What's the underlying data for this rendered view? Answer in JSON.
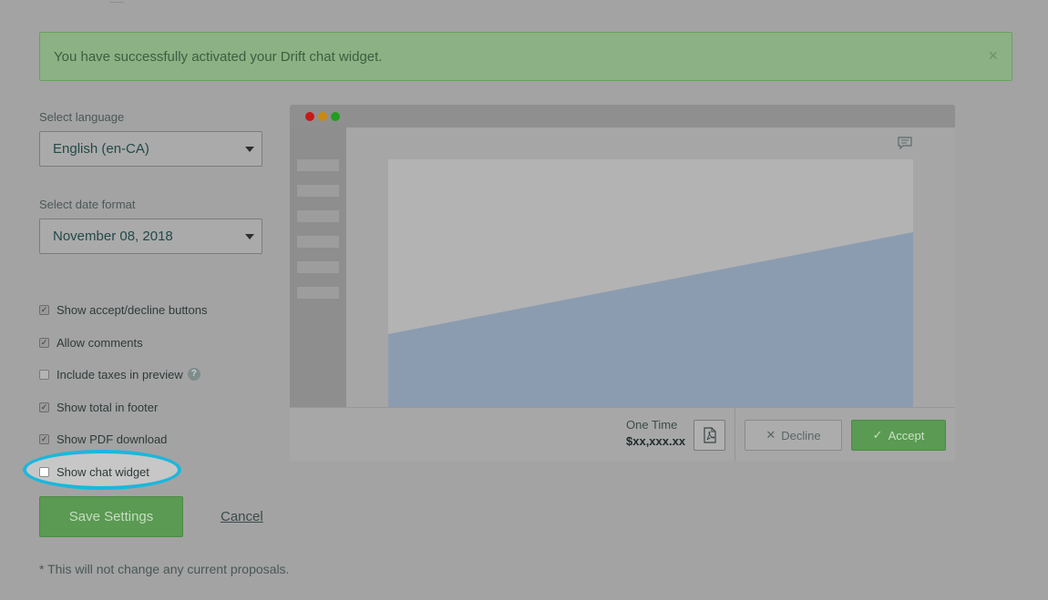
{
  "banner": {
    "message": "You have successfully activated your Drift chat widget.",
    "close_glyph": "×"
  },
  "language": {
    "label": "Select language",
    "value": "English (en-CA)"
  },
  "date_format": {
    "label": "Select date format",
    "value": "November 08, 2018"
  },
  "options": [
    {
      "label": "Show accept/decline buttons",
      "checked": true
    },
    {
      "label": "Allow comments",
      "checked": true
    },
    {
      "label": "Include taxes in preview",
      "checked": false,
      "help": "?"
    },
    {
      "label": "Show total in footer",
      "checked": true
    },
    {
      "label": "Show PDF download",
      "checked": true
    },
    {
      "label": "Show chat widget",
      "checked": false,
      "highlighted": true
    }
  ],
  "check_glyph": "✓",
  "actions": {
    "save_label": "Save Settings",
    "cancel_label": "Cancel"
  },
  "footnote": "* This will not change any current proposals.",
  "preview": {
    "window_dots": [
      "#c81818",
      "#c98a14",
      "#1f9e1f"
    ],
    "price_label": "One Time",
    "price_value": "$xx,xxx.xx",
    "decline_label": "Decline",
    "decline_glyph": "✕",
    "accept_label": "Accept",
    "accept_glyph": "✓"
  },
  "colors": {
    "accent_green": "#5a9a52",
    "highlight_ring": "#1ab7dd",
    "chart_area": "#8c9cb0"
  }
}
